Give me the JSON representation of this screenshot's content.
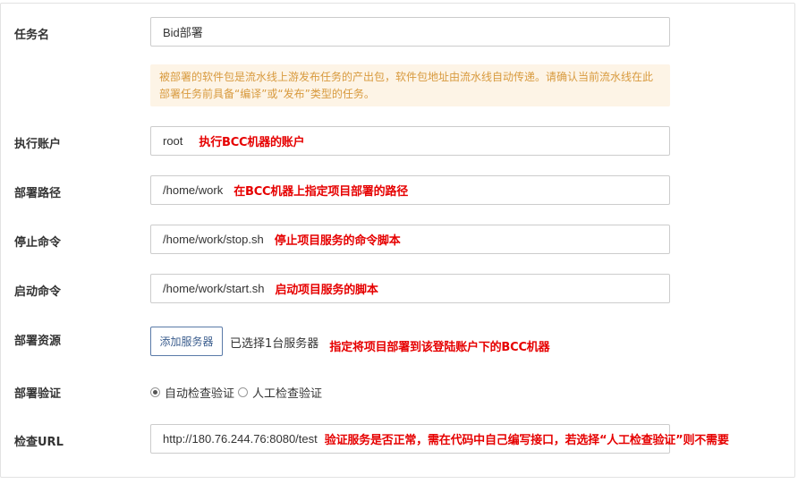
{
  "form": {
    "task_name": {
      "label": "任务名",
      "value": "Bid部署"
    },
    "tip": "被部署的软件包是流水线上游发布任务的产出包，软件包地址由流水线自动传递。请确认当前流水线在此部署任务前具备“编译”或“发布”类型的任务。",
    "exec_account": {
      "label": "执行账户",
      "value": "root",
      "note": "执行BCC机器的账户"
    },
    "deploy_path": {
      "label": "部署路径",
      "value": "/home/work",
      "note": "在BCC机器上指定项目部署的路径"
    },
    "stop_cmd": {
      "label": "停止命令",
      "value": "/home/work/stop.sh",
      "note": "停止项目服务的命令脚本"
    },
    "start_cmd": {
      "label": "启动命令",
      "value": "/home/work/start.sh",
      "note": "启动项目服务的脚本"
    },
    "resource": {
      "label": "部署资源",
      "button": "添加服务器",
      "selected": "已选择1台服务器",
      "note": "指定将项目部署到该登陆账户下的BCC机器"
    },
    "verify": {
      "label": "部署验证",
      "options": [
        "自动检查验证",
        "人工检查验证"
      ],
      "selected": 0
    },
    "check_url": {
      "label": "检查URL",
      "value": "http://180.76.244.76:8080/test",
      "note": "验证服务是否正常，需在代码中自己编写接口，若选择“人工检查验证”则不需要"
    }
  },
  "colors": {
    "note": "#e60000",
    "tip_bg": "#fdf4e6",
    "tip_text": "#d89a3e",
    "button_border": "#5a7aa8"
  }
}
